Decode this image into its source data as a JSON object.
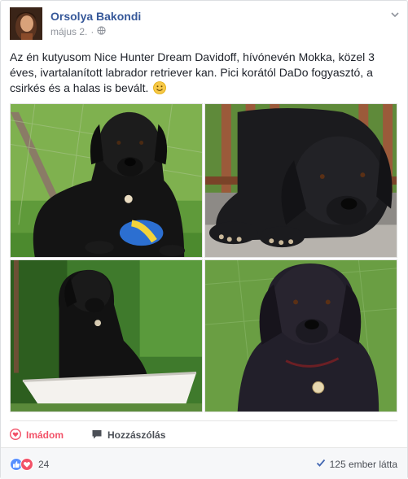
{
  "post": {
    "author": "Orsolya Bakondi",
    "date": "május 2.",
    "privacy_icon": "globe-icon",
    "text": "Az én kutyusom Nice Hunter Dream Davidoff, hívónevén Mokka, közel 3 éves, ivartalanított labrador retriever kan. Pici korától DaDo fogyasztó, a csirkés és a halas is bevált.",
    "emoji": "smiley-emoji"
  },
  "photos": [
    {
      "subject": "black labrador sitting on grass with blue-yellow toy"
    },
    {
      "subject": "black labrador lying on wooden deck"
    },
    {
      "subject": "black labrador sitting in white tub"
    },
    {
      "subject": "black labrador portrait close-up"
    }
  ],
  "actions": {
    "love_label": "Imádom",
    "comment_label": "Hozzászólás"
  },
  "footer": {
    "reaction_count": "24",
    "seen_by": "125 ember látta"
  },
  "colors": {
    "author": "#365899",
    "love": "#f25268",
    "like": "#5890ff",
    "footer_bg": "#f6f7f9"
  }
}
